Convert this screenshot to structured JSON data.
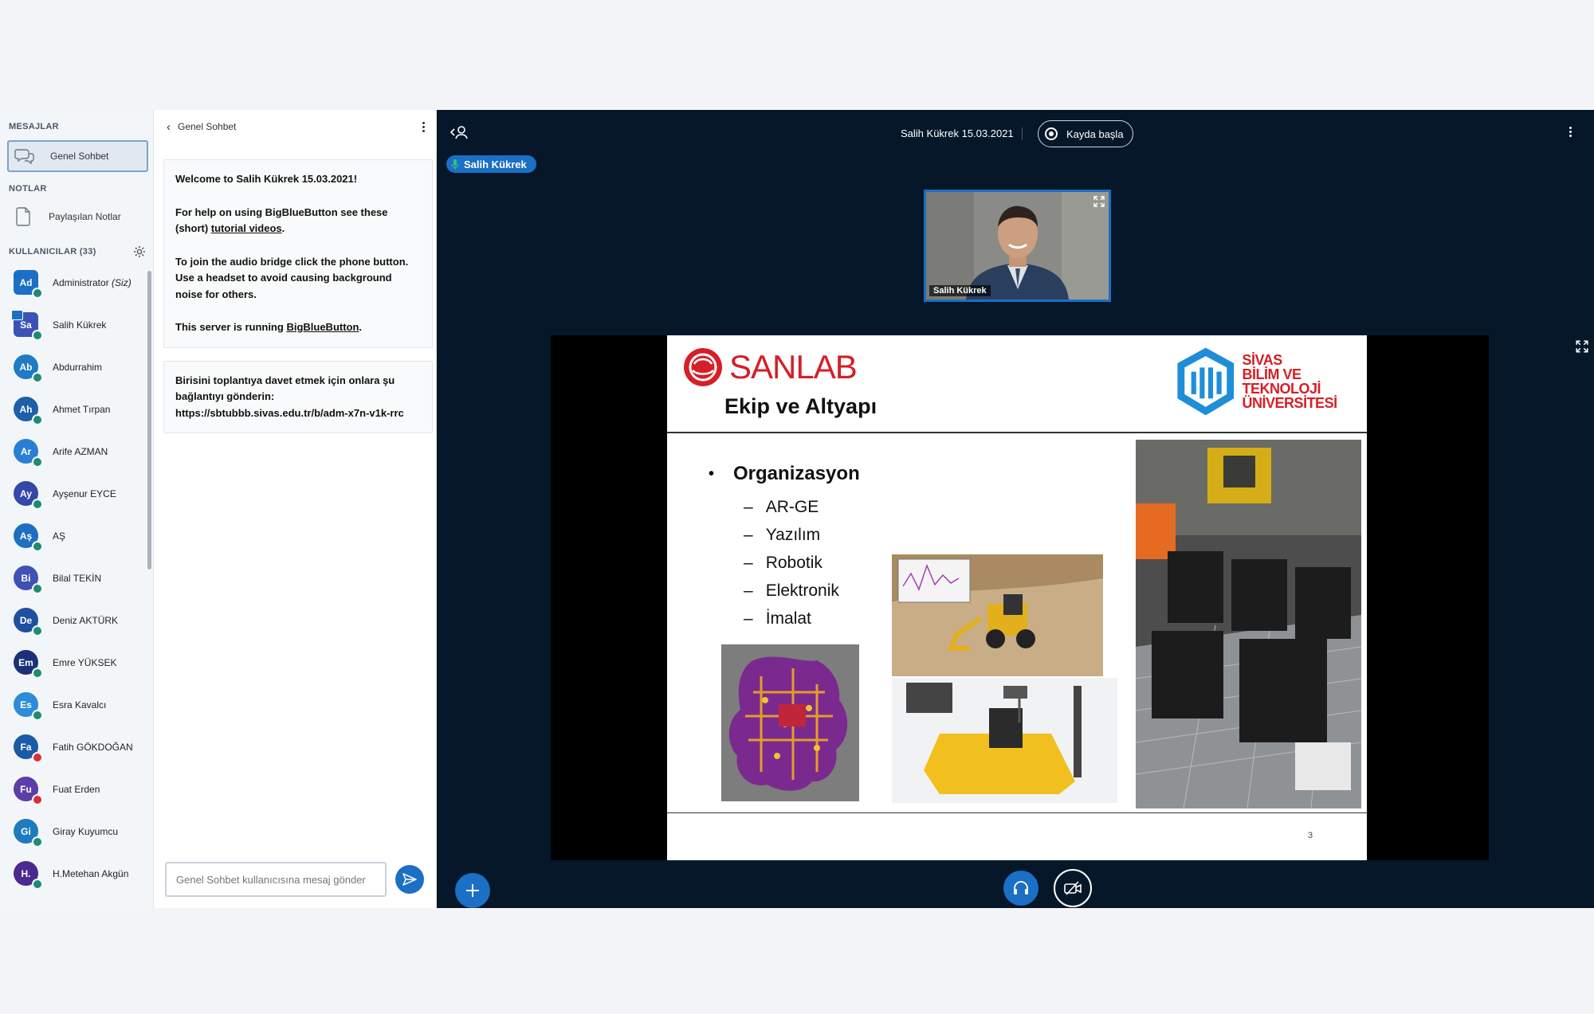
{
  "sidebar": {
    "messages_title": "MESAJLAR",
    "public_chat": "Genel Sohbet",
    "notes_title": "NOTLAR",
    "shared_notes": "Paylaşılan Notlar",
    "users_title": "KULLANICILAR (33)",
    "users": [
      {
        "initials": "Ad",
        "name": "Administrator",
        "suffix": "(Siz)",
        "color": "#1b6fc4",
        "status": "#1e8a74",
        "round": false
      },
      {
        "initials": "Sa",
        "name": "Salih Kükrek",
        "suffix": "",
        "color": "#3d52b5",
        "status": "#1e8a74",
        "round": false
      },
      {
        "initials": "Ab",
        "name": "Abdurrahim",
        "suffix": "",
        "color": "#1e7bc4",
        "status": "#1e8a74",
        "round": true
      },
      {
        "initials": "Ah",
        "name": "Ahmet Tırpan",
        "suffix": "",
        "color": "#1e5fa8",
        "status": "#1e8a74",
        "round": true
      },
      {
        "initials": "Ar",
        "name": "Arife AZMAN",
        "suffix": "",
        "color": "#2a7fd4",
        "status": "#1e8a74",
        "round": true
      },
      {
        "initials": "Ay",
        "name": "Ayşenur EYCE",
        "suffix": "",
        "color": "#3448a8",
        "status": "#1e8a74",
        "round": true
      },
      {
        "initials": "Aş",
        "name": "AŞ",
        "suffix": "",
        "color": "#1e6fc0",
        "status": "#1e8a74",
        "round": true
      },
      {
        "initials": "Bi",
        "name": "Bilal TEKİN",
        "suffix": "",
        "color": "#3f51b5",
        "status": "#1e8a74",
        "round": true
      },
      {
        "initials": "De",
        "name": "Deniz AKTÜRK",
        "suffix": "",
        "color": "#1f4fa0",
        "status": "#1e8a74",
        "round": true
      },
      {
        "initials": "Em",
        "name": "Emre YÜKSEK",
        "suffix": "",
        "color": "#1c2f7a",
        "status": "#1e8a74",
        "round": true
      },
      {
        "initials": "Es",
        "name": "Esra Kavalcı",
        "suffix": "",
        "color": "#2d8bd8",
        "status": "#1e8a74",
        "round": true
      },
      {
        "initials": "Fa",
        "name": "Fatih GÖKDOĞAN",
        "suffix": "",
        "color": "#1b5aa6",
        "status": "#d9303d",
        "round": true
      },
      {
        "initials": "Fu",
        "name": "Fuat Erden",
        "suffix": "",
        "color": "#5b3ea8",
        "status": "#d9303d",
        "round": true
      },
      {
        "initials": "Gi",
        "name": "Giray Kuyumcu",
        "suffix": "",
        "color": "#1e7bbd",
        "status": "#1e8a74",
        "round": true
      },
      {
        "initials": "H.",
        "name": "H.Metehan Akgün",
        "suffix": "",
        "color": "#4a2a8f",
        "status": "#1e8a74",
        "round": true
      }
    ]
  },
  "chat": {
    "title": "Genel Sohbet",
    "welcome": {
      "line1": "Welcome to Salih Kükrek 15.03.2021!",
      "p2a": "For help on using BigBlueButton see these (short) ",
      "p2link": "tutorial videos",
      "p2b": ".",
      "p3": "To join the audio bridge click the phone button. Use a headset to avoid causing background noise for others.",
      "p4a": "This server is running ",
      "p4link": "BigBlueButton",
      "p4b": "."
    },
    "invite": "Birisini toplantıya davet etmek için onlara şu bağlantıyı gönderin: https://sbtubbb.sivas.edu.tr/b/adm-x7n-v1k-rrc",
    "input_placeholder": "Genel Sohbet kullanıcısına mesaj gönder"
  },
  "main": {
    "meeting_title": "Salih Kükrek 15.03.2021",
    "record_label": "Kayda başla",
    "talking_user": "Salih Kükrek",
    "webcam_name": "Salih Kükrek"
  },
  "slide": {
    "brand": "SANLAB",
    "title": "Ekip ve Altyapı",
    "uni_line1": "SİVAS",
    "uni_line2": "BİLİM VE TEKNOLOJİ",
    "uni_line3": "ÜNİVERSİTESİ",
    "bullet": "Organizasyon",
    "items": [
      "AR-GE",
      "Yazılım",
      "Robotik",
      "Elektronik",
      "İmalat"
    ],
    "page": "3"
  }
}
